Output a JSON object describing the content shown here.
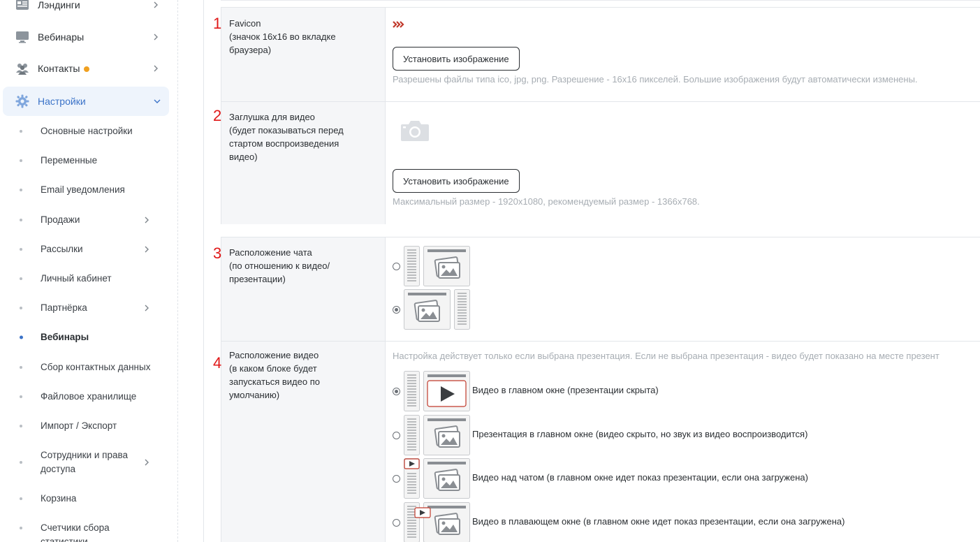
{
  "sidebar": {
    "top_items": [
      {
        "label": "Лэндинги",
        "icon": "landing-icon"
      },
      {
        "label": "Вебинары",
        "icon": "monitor-icon"
      },
      {
        "label": "Контакты",
        "icon": "users-icon",
        "badge_color": "#f0a020"
      },
      {
        "label": "Настройки",
        "icon": "gear-icon"
      }
    ],
    "sub_items": [
      {
        "label": "Основные настройки"
      },
      {
        "label": "Переменные"
      },
      {
        "label": "Email уведомления"
      },
      {
        "label": "Продажи"
      },
      {
        "label": "Рассылки"
      },
      {
        "label": "Личный кабинет"
      },
      {
        "label": "Партнёрка"
      },
      {
        "label": "Вебинары"
      },
      {
        "label": "Сбор контактных данных"
      },
      {
        "label": "Файловое хранилище"
      },
      {
        "label": "Импорт / Экспорт"
      },
      {
        "label": "Сотрудники и права доступа"
      },
      {
        "label": "Корзина"
      },
      {
        "label": "Счетчики сбора статистики"
      }
    ]
  },
  "settings": {
    "favicon": {
      "number": "1",
      "label": "Favicon\n(значок 16x16 во вкладке браузера)",
      "button": "Установить изображение",
      "hint": "Разрешены файлы типа ico, jpg, png. Разрешение - 16x16 пикселей. Большие изображения будут автоматически изменены."
    },
    "video_placeholder": {
      "number": "2",
      "label": "Заглушка для видео\n(будет показываться перед стартом воспроизведения видео)",
      "button": "Установить изображение",
      "hint": "Максимальный размер - 1920x1080, рекомендуемый размер - 1366x768."
    },
    "chat_position": {
      "number": "3",
      "label": "Расположение чата\n(по отношению к видео/презентации)",
      "selected_index": 1
    },
    "video_position": {
      "number": "4",
      "label": "Расположение видео\n(в каком блоке будет запускаться видео по умолчанию)",
      "hint": "Настройка действует только если выбрана презентация. Если не выбрана презентация - видео будет показано на месте презент",
      "selected_index": 0,
      "options": [
        {
          "label": "Видео в главном окне (презентации скрыта)"
        },
        {
          "label": "Презентация в главном окне (видео скрыто, но звук из видео воспроизводится)"
        },
        {
          "label": "Видео над чатом (в главном окне идет показ презентации, если она загружена)"
        },
        {
          "label": "Видео в плавающем окне (в главном окне идет показ презентации, если она загружена)"
        }
      ]
    }
  },
  "colors": {
    "accent": "#3b73c8",
    "annotation": "#e01818",
    "favicon_red": "#c0392b"
  }
}
